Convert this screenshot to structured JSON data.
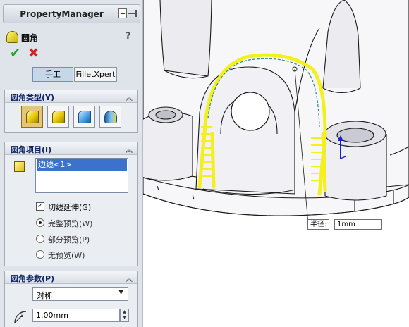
{
  "panel": {
    "title": "PropertyManager",
    "feature_title": "圆角",
    "help": "?",
    "ok": "✔",
    "cancel": "✖",
    "modes": {
      "manual": "手工",
      "filletxpert": "FilletXpert",
      "selected": "manual"
    }
  },
  "fillet_type": {
    "header": "圆角类型(Y)",
    "types": [
      "constant-radius-fillet-icon",
      "variable-radius-fillet-icon",
      "face-fillet-icon",
      "full-round-fillet-icon"
    ],
    "selected_index": 0
  },
  "fillet_items": {
    "header": "圆角项目(I)",
    "edges": [
      "边线<1>"
    ],
    "tangent_propagation": {
      "label": "切线延伸(G)",
      "checked": true
    },
    "preview_options": [
      {
        "label": "完整预览(W)",
        "selected": true
      },
      {
        "label": "部分预览(P)",
        "selected": false
      },
      {
        "label": "无预览(W)",
        "selected": false
      }
    ]
  },
  "fillet_params": {
    "header": "圆角参数(P)",
    "profile": "对称",
    "radius": "1.00mm"
  },
  "viewport": {
    "dimension_label": "半径:",
    "dimension_value": "1mm",
    "colors": {
      "highlight": "#f4ef1e",
      "edge_preview": "#2a8a8c",
      "model_line": "#1a1a1a",
      "triad": "#1b1bdc"
    }
  }
}
